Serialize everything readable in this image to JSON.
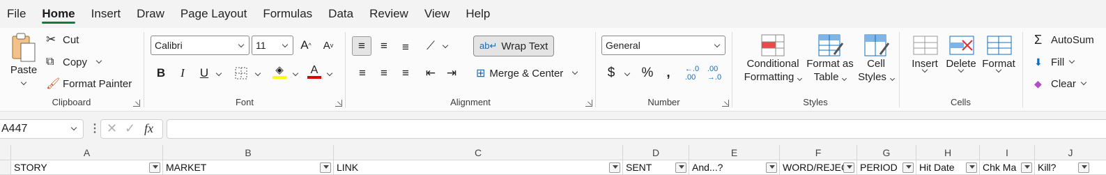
{
  "menu": [
    "File",
    "Home",
    "Insert",
    "Draw",
    "Page Layout",
    "Formulas",
    "Data",
    "Review",
    "View",
    "Help"
  ],
  "clipboard": {
    "paste": "Paste",
    "cut": "Cut",
    "copy": "Copy",
    "format_painter": "Format Painter",
    "label": "Clipboard"
  },
  "font": {
    "name": "Calibri",
    "size": "11",
    "label": "Font",
    "colors": {
      "highlight": "#ffff00",
      "font": "#e00000"
    }
  },
  "alignment": {
    "wrap_text": "Wrap Text",
    "merge_center": "Merge & Center",
    "label": "Alignment"
  },
  "number": {
    "format": "General",
    "label": "Number"
  },
  "styles": {
    "conditional": [
      "Conditional",
      "Formatting"
    ],
    "format_table": [
      "Format as",
      "Table"
    ],
    "cell_styles": [
      "Cell",
      "Styles"
    ],
    "label": "Styles"
  },
  "cells": {
    "insert": "Insert",
    "delete": "Delete",
    "format": "Format",
    "label": "Cells"
  },
  "editing": {
    "autosum": "AutoSum",
    "fill": "Fill",
    "clear": "Clear"
  },
  "formula_bar": {
    "name_box": "A447",
    "formula": ""
  },
  "columns": [
    "A",
    "B",
    "C",
    "D",
    "E",
    "F",
    "G",
    "H",
    "I",
    "J"
  ],
  "header_row": [
    "STORY",
    "MARKET",
    "LINK",
    "SENT",
    "And...?",
    "WORD/REJEC",
    "PERIOD",
    "Hit Date",
    "Chk Ma",
    "Kill?"
  ],
  "accent": "#107c41"
}
